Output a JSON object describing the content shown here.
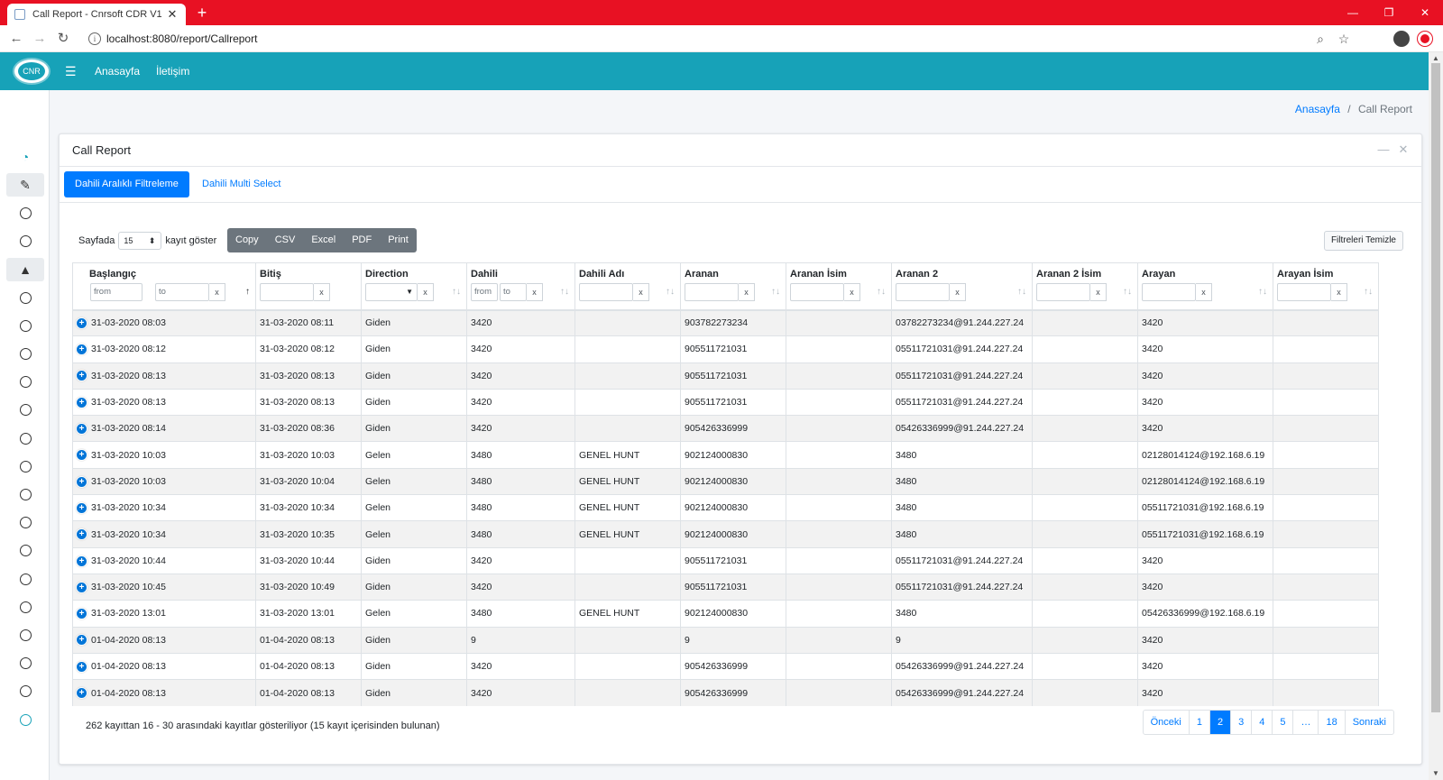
{
  "browser": {
    "tab_title": "Call Report - Cnrsoft CDR V1",
    "url": "localhost:8080/report/Callreport"
  },
  "header": {
    "logo_text": "CNR",
    "nav": [
      "Anasayfa",
      "İletişim"
    ]
  },
  "breadcrumb": {
    "home": "Anasayfa",
    "separator": "/",
    "current": "Call Report"
  },
  "card": {
    "title": "Call Report",
    "tabs": [
      "Dahili Aralıklı Filtreleme",
      "Dahili Multi Select"
    ],
    "active_tab": 0
  },
  "controls": {
    "length_prefix": "Sayfada",
    "length_value": "15",
    "length_suffix": "kayıt göster",
    "buttons": [
      "Copy",
      "CSV",
      "Excel",
      "PDF",
      "Print"
    ],
    "clear_filters": "Filtreleri Temizle"
  },
  "table": {
    "columns": [
      "Başlangıç",
      "Bitiş",
      "Direction",
      "Dahili",
      "Dahili Adı",
      "Aranan",
      "Aranan İsim",
      "Aranan 2",
      "Aranan 2 İsim",
      "Arayan",
      "Arayan İsim"
    ],
    "filters": {
      "from": "from",
      "to": "to",
      "clear": "x"
    },
    "rows": [
      [
        "31-03-2020 08:03",
        "31-03-2020 08:11",
        "Giden",
        "3420",
        "",
        "903782273234",
        "",
        "03782273234@91.244.227.24",
        "",
        "3420",
        ""
      ],
      [
        "31-03-2020 08:12",
        "31-03-2020 08:12",
        "Giden",
        "3420",
        "",
        "905511721031",
        "",
        "05511721031@91.244.227.24",
        "",
        "3420",
        ""
      ],
      [
        "31-03-2020 08:13",
        "31-03-2020 08:13",
        "Giden",
        "3420",
        "",
        "905511721031",
        "",
        "05511721031@91.244.227.24",
        "",
        "3420",
        ""
      ],
      [
        "31-03-2020 08:13",
        "31-03-2020 08:13",
        "Giden",
        "3420",
        "",
        "905511721031",
        "",
        "05511721031@91.244.227.24",
        "",
        "3420",
        ""
      ],
      [
        "31-03-2020 08:14",
        "31-03-2020 08:36",
        "Giden",
        "3420",
        "",
        "905426336999",
        "",
        "05426336999@91.244.227.24",
        "",
        "3420",
        ""
      ],
      [
        "31-03-2020 10:03",
        "31-03-2020 10:03",
        "Gelen",
        "3480",
        "GENEL HUNT",
        "902124000830",
        "",
        "3480",
        "",
        "02128014124@192.168.6.19",
        ""
      ],
      [
        "31-03-2020 10:03",
        "31-03-2020 10:04",
        "Gelen",
        "3480",
        "GENEL HUNT",
        "902124000830",
        "",
        "3480",
        "",
        "02128014124@192.168.6.19",
        ""
      ],
      [
        "31-03-2020 10:34",
        "31-03-2020 10:34",
        "Gelen",
        "3480",
        "GENEL HUNT",
        "902124000830",
        "",
        "3480",
        "",
        "05511721031@192.168.6.19",
        ""
      ],
      [
        "31-03-2020 10:34",
        "31-03-2020 10:35",
        "Gelen",
        "3480",
        "GENEL HUNT",
        "902124000830",
        "",
        "3480",
        "",
        "05511721031@192.168.6.19",
        ""
      ],
      [
        "31-03-2020 10:44",
        "31-03-2020 10:44",
        "Giden",
        "3420",
        "",
        "905511721031",
        "",
        "05511721031@91.244.227.24",
        "",
        "3420",
        ""
      ],
      [
        "31-03-2020 10:45",
        "31-03-2020 10:49",
        "Giden",
        "3420",
        "",
        "905511721031",
        "",
        "05511721031@91.244.227.24",
        "",
        "3420",
        ""
      ],
      [
        "31-03-2020 13:01",
        "31-03-2020 13:01",
        "Gelen",
        "3480",
        "GENEL HUNT",
        "902124000830",
        "",
        "3480",
        "",
        "05426336999@192.168.6.19",
        ""
      ],
      [
        "01-04-2020 08:13",
        "01-04-2020 08:13",
        "Giden",
        "9",
        "",
        "9",
        "",
        "9",
        "",
        "3420",
        ""
      ],
      [
        "01-04-2020 08:13",
        "01-04-2020 08:13",
        "Giden",
        "3420",
        "",
        "905426336999",
        "",
        "05426336999@91.244.227.24",
        "",
        "3420",
        ""
      ],
      [
        "01-04-2020 08:13",
        "01-04-2020 08:13",
        "Giden",
        "3420",
        "",
        "905426336999",
        "",
        "05426336999@91.244.227.24",
        "",
        "3420",
        ""
      ]
    ]
  },
  "footer": {
    "info": "262 kayıttan 16 - 30 arasındaki kayıtlar gösteriliyor (15 kayıt içerisinden bulunan)",
    "pagination": [
      "Önceki",
      "1",
      "2",
      "3",
      "4",
      "5",
      "…",
      "18",
      "Sonraki"
    ],
    "active_page": "2"
  },
  "colors": {
    "titlebar": "#e81123",
    "appbar": "#17a2b8",
    "primary": "#007bff",
    "buttons": "#6c757d"
  }
}
